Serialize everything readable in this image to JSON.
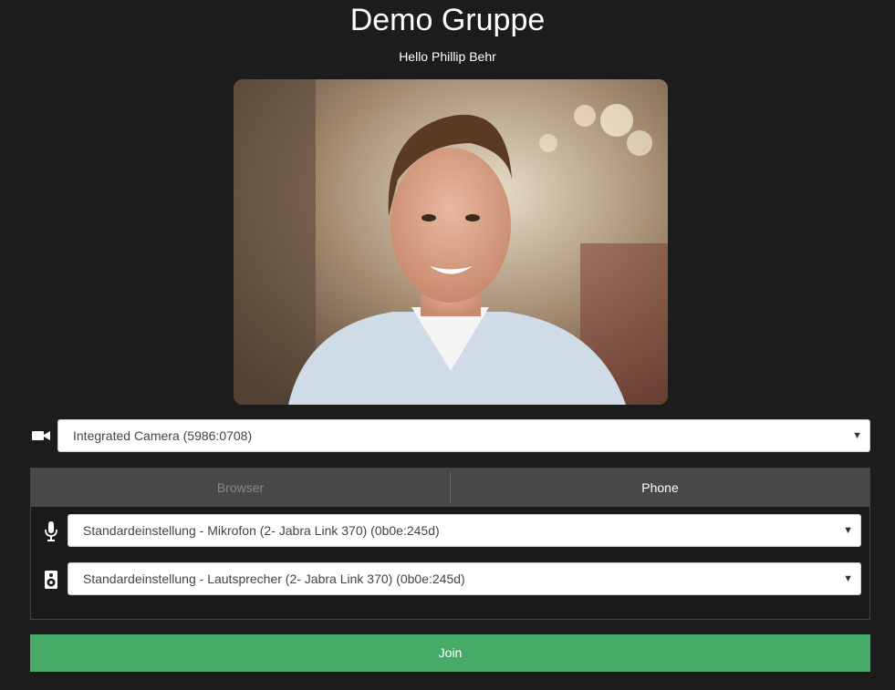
{
  "header": {
    "title": "Demo Gruppe",
    "greeting": "Hello Phillip Behr"
  },
  "video": {
    "camera_icon": "video-camera-icon",
    "camera_select_value": "Integrated Camera (5986:0708)"
  },
  "audio": {
    "tabs": [
      {
        "label": "Browser",
        "active": false
      },
      {
        "label": "Phone",
        "active": true
      }
    ],
    "microphone_icon": "microphone-icon",
    "microphone_value": "Standardeinstellung - Mikrofon (2- Jabra Link 370) (0b0e:245d)",
    "speaker_icon": "speaker-icon",
    "speaker_value": "Standardeinstellung - Lautsprecher (2- Jabra Link 370) (0b0e:245d)"
  },
  "actions": {
    "join_label": "Join"
  },
  "colors": {
    "background": "#1c1c1c",
    "join_button": "#48aa67",
    "tab_bar": "#4a4846"
  }
}
